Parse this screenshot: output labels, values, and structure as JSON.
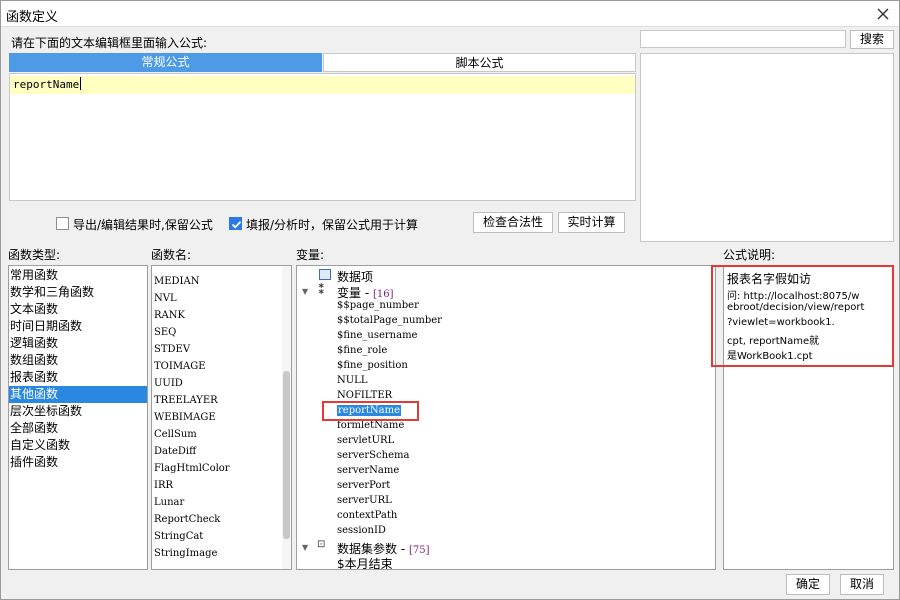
{
  "window": {
    "title": "函数定义"
  },
  "prompt": "请在下面的文本编辑框里面输入公式:",
  "tabs": [
    {
      "label": "常规公式"
    },
    {
      "label": "脚本公式"
    }
  ],
  "editor": {
    "value": "reportName"
  },
  "search": {
    "value": "",
    "button": "搜索"
  },
  "options": {
    "export_keep": {
      "label": "导出/编辑结果时,保留公式",
      "checked": false
    },
    "fill_keep": {
      "label": "填报/分析时，保留公式用于计算",
      "checked": true
    }
  },
  "buttons": {
    "check": "检查合法性",
    "realtime": "实时计算",
    "ok": "确定",
    "cancel": "取消"
  },
  "headers": {
    "types": "函数类型:",
    "names": "函数名:",
    "vars": "变量:",
    "desc": "公式说明:"
  },
  "function_types": [
    "常用函数",
    "数学和三角函数",
    "文本函数",
    "时间日期函数",
    "逻辑函数",
    "数组函数",
    "报表函数",
    "其他函数",
    "层次坐标函数",
    "全部函数",
    "自定义函数",
    "插件函数"
  ],
  "function_types_selected": 7,
  "function_names": [
    "MEDIAN",
    "NVL",
    "RANK",
    "SEQ",
    "STDEV",
    "TOIMAGE",
    "UUID",
    "TREELAYER",
    "WEBIMAGE",
    "CellSum",
    "DateDiff",
    "FlagHtmlColor",
    "IRR",
    "Lunar",
    "ReportCheck",
    "StringCat",
    "StringImage"
  ],
  "variables": {
    "data_item": "数据项",
    "vars_group": {
      "label": "变量",
      "count": "[16]"
    },
    "vars": [
      "$$page_number",
      "$$totalPage_number",
      "$fine_username",
      "$fine_role",
      "$fine_position",
      "NULL",
      "NOFILTER",
      "reportName",
      "formletName",
      "servletURL",
      "serverSchema",
      "serverName",
      "serverPort",
      "serverURL",
      "contextPath",
      "sessionID"
    ],
    "selected": "reportName",
    "dataset_group": {
      "label": "数据集参数",
      "count": "[75]"
    },
    "dataset_first": "$本月结束"
  },
  "description": {
    "lines": [
      "报表名字假如访",
      "问: http://localhost:8075/w",
      "ebroot/decision/view/report",
      "?viewlet=workbook1.",
      "cpt, reportName就",
      "是WorkBook1.cpt"
    ]
  },
  "colors": {
    "accent": "#4d9be6",
    "selection": "#2b88e0",
    "highlight_box": "#e53935",
    "editor_line": "#ffffc2"
  }
}
